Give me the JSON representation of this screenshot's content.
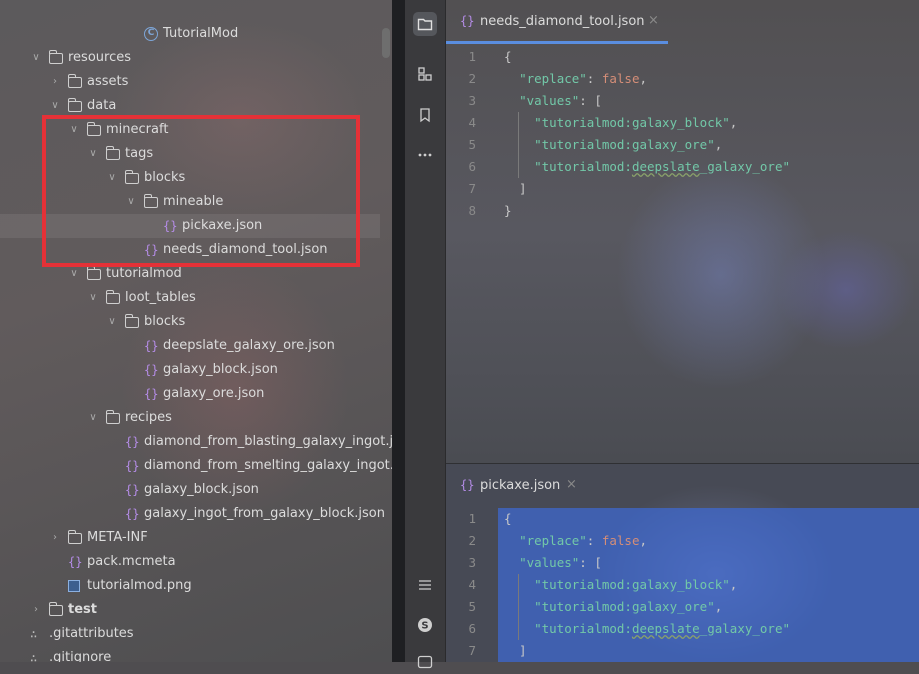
{
  "project_tree": {
    "items": [
      {
        "label": "TutorialMod",
        "icon": "class-icon",
        "indent": 6,
        "chevron": ""
      },
      {
        "label": "resources",
        "icon": "resources-folder-icon",
        "indent": 1,
        "chevron": "expanded"
      },
      {
        "label": "assets",
        "icon": "folder-icon",
        "indent": 2,
        "chevron": "collapsed"
      },
      {
        "label": "data",
        "icon": "folder-icon",
        "indent": 2,
        "chevron": "expanded"
      },
      {
        "label": "minecraft",
        "icon": "folder-icon",
        "indent": 3,
        "chevron": "expanded"
      },
      {
        "label": "tags",
        "icon": "folder-icon",
        "indent": 4,
        "chevron": "expanded"
      },
      {
        "label": "blocks",
        "icon": "folder-icon",
        "indent": 5,
        "chevron": "expanded"
      },
      {
        "label": "mineable",
        "icon": "folder-icon",
        "indent": 6,
        "chevron": "expanded"
      },
      {
        "label": "pickaxe.json",
        "icon": "json-icon",
        "indent": 7,
        "chevron": "",
        "selected": true
      },
      {
        "label": "needs_diamond_tool.json",
        "icon": "json-icon",
        "indent": 6,
        "chevron": ""
      },
      {
        "label": "tutorialmod",
        "icon": "folder-icon",
        "indent": 3,
        "chevron": "expanded"
      },
      {
        "label": "loot_tables",
        "icon": "folder-icon",
        "indent": 4,
        "chevron": "expanded"
      },
      {
        "label": "blocks",
        "icon": "folder-icon",
        "indent": 5,
        "chevron": "expanded"
      },
      {
        "label": "deepslate_galaxy_ore.json",
        "icon": "json-icon",
        "indent": 6,
        "chevron": ""
      },
      {
        "label": "galaxy_block.json",
        "icon": "json-icon",
        "indent": 6,
        "chevron": ""
      },
      {
        "label": "galaxy_ore.json",
        "icon": "json-icon",
        "indent": 6,
        "chevron": ""
      },
      {
        "label": "recipes",
        "icon": "folder-icon",
        "indent": 4,
        "chevron": "expanded"
      },
      {
        "label": "diamond_from_blasting_galaxy_ingot.json",
        "icon": "json-icon",
        "indent": 5,
        "chevron": ""
      },
      {
        "label": "diamond_from_smelting_galaxy_ingot.json",
        "icon": "json-icon",
        "indent": 5,
        "chevron": ""
      },
      {
        "label": "galaxy_block.json",
        "icon": "json-icon",
        "indent": 5,
        "chevron": ""
      },
      {
        "label": "galaxy_ingot_from_galaxy_block.json",
        "icon": "json-icon",
        "indent": 5,
        "chevron": ""
      },
      {
        "label": "META-INF",
        "icon": "folder-icon",
        "indent": 2,
        "chevron": "collapsed"
      },
      {
        "label": "pack.mcmeta",
        "icon": "json-icon",
        "indent": 2,
        "chevron": ""
      },
      {
        "label": "tutorialmod.png",
        "icon": "image-icon",
        "indent": 2,
        "chevron": ""
      },
      {
        "label": "test",
        "icon": "folder-icon",
        "indent": 1,
        "chevron": "collapsed",
        "bold": true
      },
      {
        "label": ".gitattributes",
        "icon": "git-icon",
        "indent": 0,
        "chevron": ""
      },
      {
        "label": ".gitignore",
        "icon": "git-icon",
        "indent": 0,
        "chevron": ""
      }
    ]
  },
  "side_strip": {
    "icons": [
      "project-icon",
      "structure-icon",
      "bookmark-icon",
      "more-icon",
      "list-icon",
      "s-icon",
      "terminal-icon"
    ]
  },
  "editor_top": {
    "tab_label": "needs_diamond_tool.json",
    "tab_icon": "{}",
    "close": "×",
    "lines": [
      {
        "n": "1",
        "tokens": [
          [
            "punc",
            "{"
          ]
        ]
      },
      {
        "n": "2",
        "tokens": [
          [
            "punc",
            "  "
          ],
          [
            "s",
            "\"replace\""
          ],
          [
            "punc",
            ": "
          ],
          [
            "k",
            "false"
          ],
          [
            "punc",
            ","
          ]
        ]
      },
      {
        "n": "3",
        "tokens": [
          [
            "punc",
            "  "
          ],
          [
            "s",
            "\"values\""
          ],
          [
            "punc",
            ": ["
          ]
        ]
      },
      {
        "n": "4",
        "tokens": [
          [
            "punc",
            "    "
          ],
          [
            "s",
            "\"tutorialmod:galaxy_block\""
          ],
          [
            "punc",
            ","
          ]
        ]
      },
      {
        "n": "5",
        "tokens": [
          [
            "punc",
            "    "
          ],
          [
            "s",
            "\"tutorialmod:galaxy_ore\""
          ],
          [
            "punc",
            ","
          ]
        ]
      },
      {
        "n": "6",
        "tokens": [
          [
            "punc",
            "    "
          ],
          [
            "s",
            "\"tutorialmod:"
          ],
          [
            "sq",
            "deepslate"
          ],
          [
            "s",
            "_galaxy_ore\""
          ]
        ]
      },
      {
        "n": "7",
        "tokens": [
          [
            "punc",
            "  ]"
          ]
        ]
      },
      {
        "n": "8",
        "tokens": [
          [
            "punc",
            "}"
          ]
        ]
      }
    ]
  },
  "editor_bottom": {
    "tab_label": "pickaxe.json",
    "tab_icon": "{}",
    "close": "×",
    "lines": [
      {
        "n": "1",
        "tokens": [
          [
            "punc",
            "{"
          ]
        ]
      },
      {
        "n": "2",
        "tokens": [
          [
            "punc",
            "  "
          ],
          [
            "s",
            "\"replace\""
          ],
          [
            "punc",
            ": "
          ],
          [
            "k",
            "false"
          ],
          [
            "punc",
            ","
          ]
        ]
      },
      {
        "n": "3",
        "tokens": [
          [
            "punc",
            "  "
          ],
          [
            "s",
            "\"values\""
          ],
          [
            "punc",
            ": ["
          ]
        ]
      },
      {
        "n": "4",
        "tokens": [
          [
            "punc",
            "    "
          ],
          [
            "s",
            "\"tutorialmod:galaxy_block\""
          ],
          [
            "punc",
            ","
          ]
        ]
      },
      {
        "n": "5",
        "tokens": [
          [
            "punc",
            "    "
          ],
          [
            "s",
            "\"tutorialmod:galaxy_ore\""
          ],
          [
            "punc",
            ","
          ]
        ]
      },
      {
        "n": "6",
        "tokens": [
          [
            "punc",
            "    "
          ],
          [
            "s",
            "\"tutorialmod:"
          ],
          [
            "sq",
            "deepslate"
          ],
          [
            "s",
            "_galaxy_ore\""
          ]
        ]
      },
      {
        "n": "7",
        "tokens": [
          [
            "punc",
            "  ]"
          ]
        ]
      }
    ]
  },
  "colors": {
    "highlight_box": "#e53137",
    "tab_underline": "#5a8ee0",
    "string": "#72c8a8",
    "keyword": "#d58e78",
    "selection": "#3c6ee6"
  }
}
